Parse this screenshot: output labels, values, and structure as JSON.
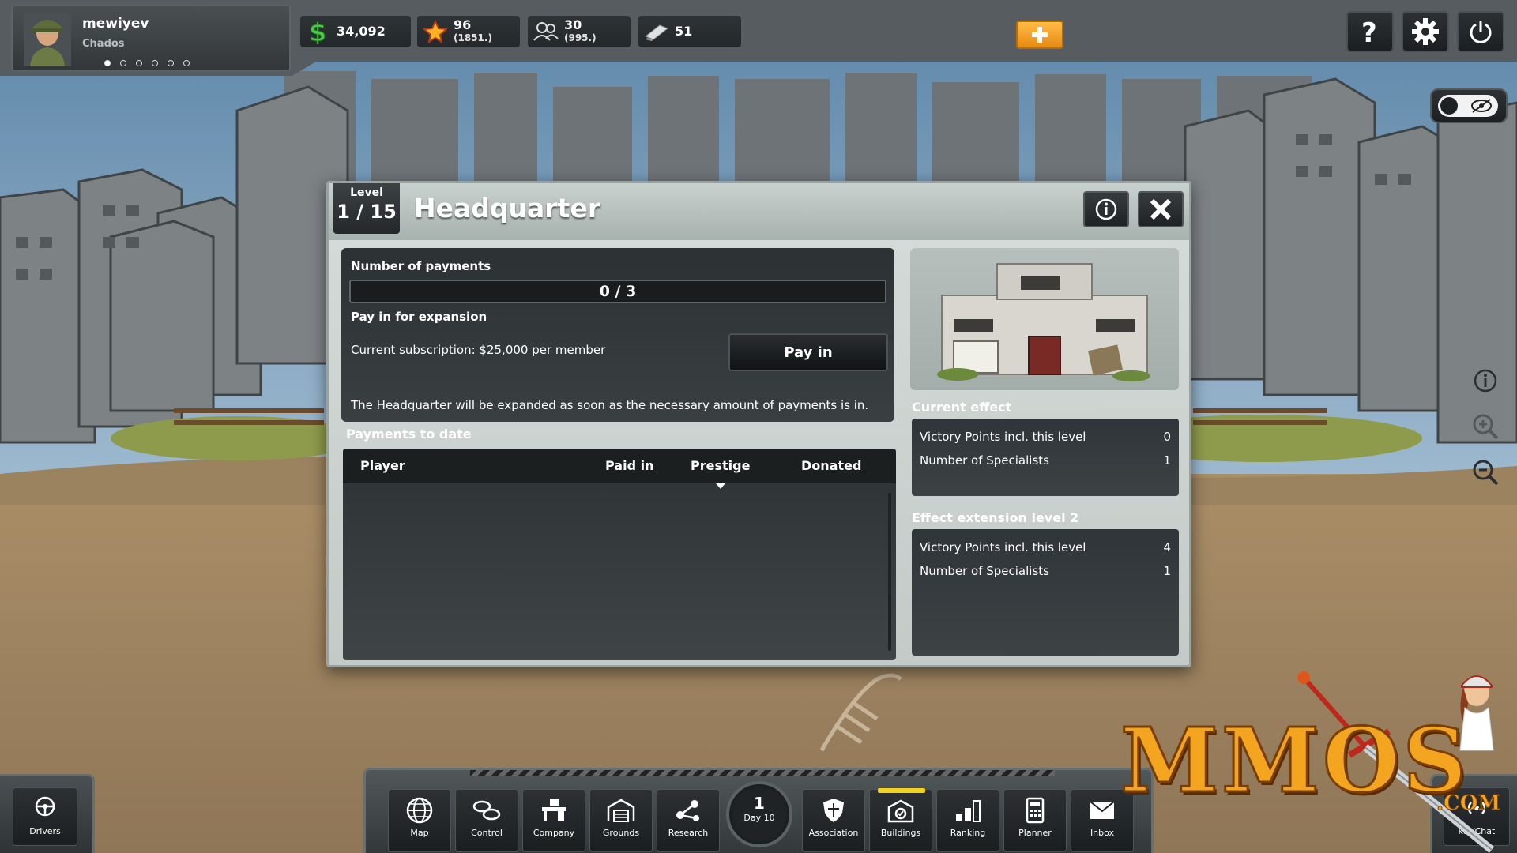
{
  "player": {
    "name": "mewiyev",
    "company": "Chados",
    "page_dots": 6,
    "active_dot": 0
  },
  "resources": {
    "money": "34,092",
    "prestige": "96",
    "prestige_sub": "(1851.)",
    "employees": "30",
    "employees_sub": "(995.)",
    "tokens": "51"
  },
  "modal": {
    "level_label": "Level",
    "level_value": "1 / 15",
    "title": "Headquarter",
    "payments_label": "Number of payments",
    "payments_progress": "0 / 3",
    "payments_fraction": 0,
    "pay_in_label": "Pay in for expansion",
    "subscription": "Current subscription: $25,000 per member",
    "pay_button": "Pay in",
    "expansion_note": "The Headquarter will be expanded as soon as the necessary amount of payments is in.",
    "payments_to_date": "Payments to date",
    "table_headers": [
      "Player",
      "Paid in",
      "Prestige",
      "Donated"
    ],
    "current_effect": {
      "title": "Current effect",
      "rows": [
        {
          "label": "Victory Points incl. this level",
          "value": "0"
        },
        {
          "label": "Number of Specialists",
          "value": "1"
        }
      ]
    },
    "next_effect": {
      "title": "Effect extension level 2",
      "rows": [
        {
          "label": "Victory Points incl. this level",
          "value": "4"
        },
        {
          "label": "Number of Specialists",
          "value": "1"
        }
      ]
    }
  },
  "nav": {
    "drivers": "Drivers",
    "map": "Map",
    "control": "Control",
    "company": "Company",
    "grounds": "Grounds",
    "research": "Research",
    "day_number": "1",
    "day_label": "Day 10",
    "association": "Association",
    "buildings": "Buildings",
    "ranking": "Ranking",
    "planner": "Planner",
    "inbox": "Inbox",
    "ticker": "ker/Chat"
  },
  "watermark": {
    "text": "MMOS",
    "suffix": ".COM"
  },
  "colors": {
    "accent_orange": "#f39a1f",
    "active_yellow": "#f2d11f",
    "panel_dark": "#2c3133"
  }
}
